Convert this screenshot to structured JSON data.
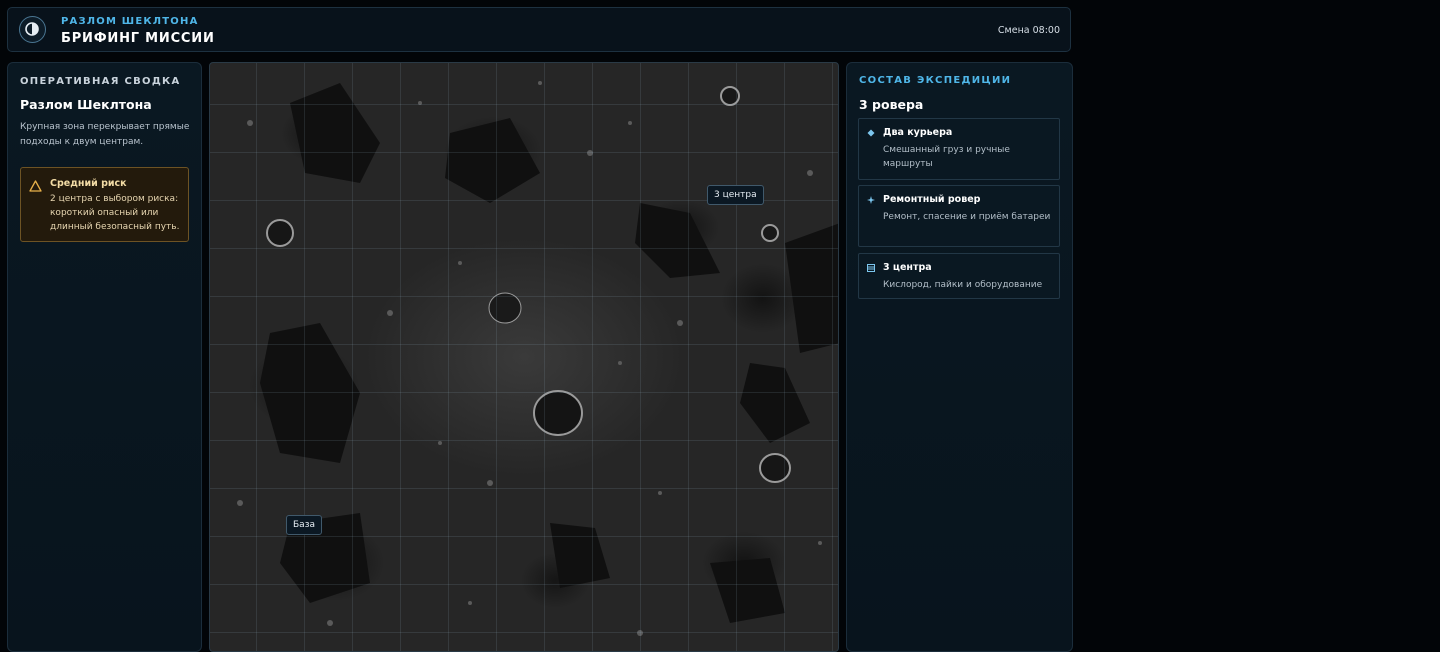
{
  "header": {
    "subtitle": "РАЗЛОМ ШЕКЛТОНА",
    "title": "БРИФИНГ МИССИИ",
    "shift": "Смена 08:00"
  },
  "brief": {
    "label": "ОПЕРАТИВНАЯ СВОДКА",
    "title": "Разлом Шеклтона",
    "description": "Крупная зона перекрывает прямые подходы к двум центрам.",
    "risk": {
      "icon": "warning-triangle-icon",
      "title": "Средний риск",
      "text": "2 центра с выбором риска: короткий опасный или длинный безопасный путь."
    }
  },
  "map": {
    "markers": [
      {
        "id": "centers",
        "label": "3 центра"
      },
      {
        "id": "base",
        "label": "База"
      }
    ]
  },
  "team": {
    "label": "СОСТАВ ЭКСПЕДИЦИИ",
    "title": "3 ровера",
    "items": [
      {
        "icon": "diamond-icon",
        "title": "Два курьера",
        "desc": "Смешанный груз и ручные маршруты"
      },
      {
        "icon": "sparkle-icon",
        "title": "Ремонтный ровер",
        "desc": "Ремонт, спасение и приём батареи"
      },
      {
        "icon": "stack-icon",
        "title": "3 центра",
        "desc": "Кислород, пайки и оборудование"
      }
    ]
  },
  "colors": {
    "accent": "#4fb6e8",
    "risk_border": "#6d5324",
    "risk_bg": "#231a0c"
  }
}
